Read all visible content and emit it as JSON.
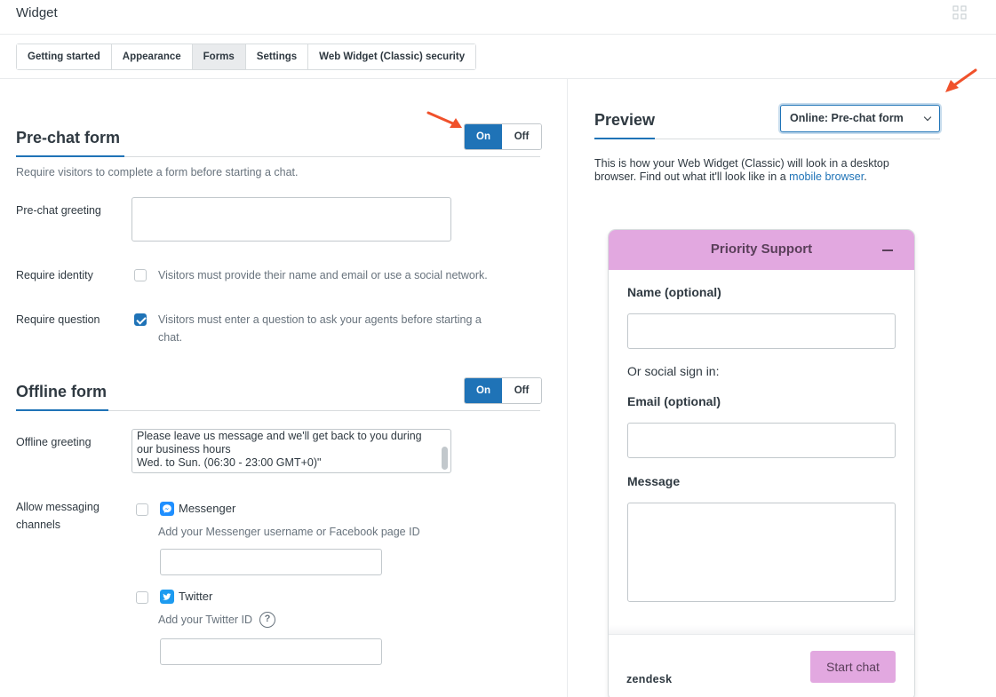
{
  "header": {
    "title": "Widget",
    "grid_icon": "grid-icon"
  },
  "tabs": [
    {
      "label": "Getting started",
      "active": false
    },
    {
      "label": "Appearance",
      "active": false
    },
    {
      "label": "Forms",
      "active": true
    },
    {
      "label": "Settings",
      "active": false
    },
    {
      "label": "Web Widget (Classic) security",
      "active": false
    }
  ],
  "prechat": {
    "title": "Pre-chat form",
    "toggle": {
      "on": "On",
      "off": "Off",
      "value": "On"
    },
    "description": "Require visitors to complete a form before starting a chat.",
    "greeting_label": "Pre-chat greeting",
    "greeting_value": "",
    "identity_label": "Require identity",
    "identity_text": "Visitors must provide their name and email or use a social network.",
    "identity_checked": false,
    "question_label": "Require question",
    "question_text_line1": "Visitors must enter a question to ask your agents before starting a",
    "question_text_line2": "chat.",
    "question_checked": true
  },
  "offline": {
    "title": "Offline form",
    "toggle": {
      "on": "On",
      "off": "Off",
      "value": "On"
    },
    "greeting_label": "Offline greeting",
    "greeting_line1": "Please leave us message and we'll get back to you during",
    "greeting_line2": "our business hours",
    "greeting_line3": "Wed. to Sun. (06:30 - 23:00 GMT+0)\"",
    "channels_label_line1": "Allow messaging",
    "channels_label_line2": "channels",
    "messenger_label": "Messenger",
    "messenger_hint": "Add your Messenger username or Facebook page ID",
    "messenger_value": "",
    "twitter_label": "Twitter",
    "twitter_hint": "Add your Twitter ID",
    "twitter_value": "",
    "help_glyph": "?"
  },
  "preview": {
    "title": "Preview",
    "select_value": "Online: Pre-chat form",
    "desc_line1": "This is how your Web Widget (Classic) will look in a desktop",
    "desc_line2_prefix": "browser. Find out what it'll look like in a ",
    "desc_link": "mobile browser",
    "desc_suffix": "."
  },
  "widget": {
    "title": "Priority Support",
    "name_label": "Name (optional)",
    "social_text": "Or social sign in:",
    "email_label": "Email (optional)",
    "message_label": "Message",
    "brand": "zendesk",
    "start_button": "Start chat",
    "header_color": "#e2a8e0"
  },
  "colors": {
    "accent": "#1f73b7",
    "annotation_arrow": "#f0512b"
  }
}
